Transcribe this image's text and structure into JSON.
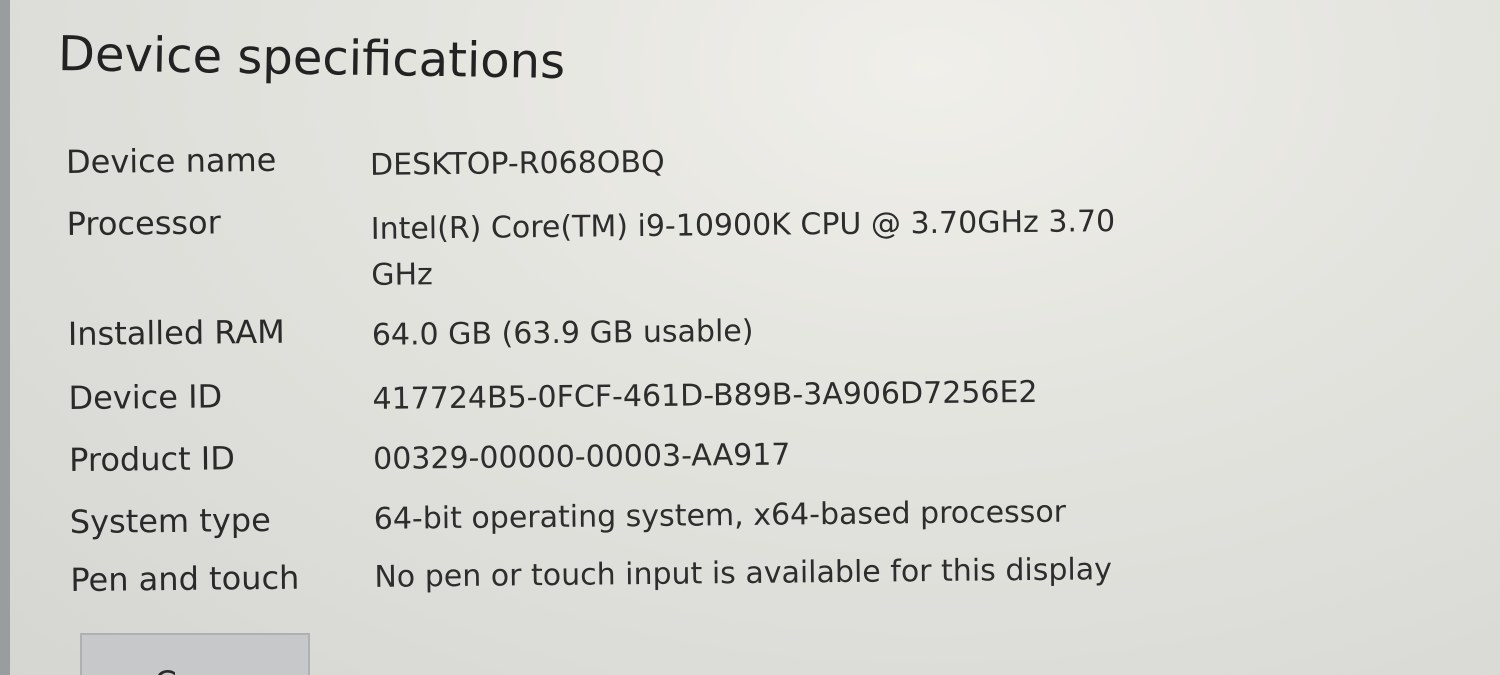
{
  "page": {
    "title": "Device specifications"
  },
  "specs": [
    {
      "label": "Device name",
      "value": "DESKTOP-R068OBQ"
    },
    {
      "label": "Processor",
      "value": "Intel(R) Core(TM) i9-10900K CPU @ 3.70GHz   3.70 GHz"
    },
    {
      "label": "Installed RAM",
      "value": "64.0 GB (63.9 GB usable)"
    },
    {
      "label": "Device ID",
      "value": "417724B5-0FCF-461D-B89B-3A906D7256E2"
    },
    {
      "label": "Product ID",
      "value": "00329-00000-00003-AA917"
    },
    {
      "label": "System type",
      "value": "64-bit operating system, x64-based processor"
    },
    {
      "label": "Pen and touch",
      "value": "No pen or touch input is available for this display"
    }
  ],
  "actions": {
    "copy_label": "Copy"
  }
}
